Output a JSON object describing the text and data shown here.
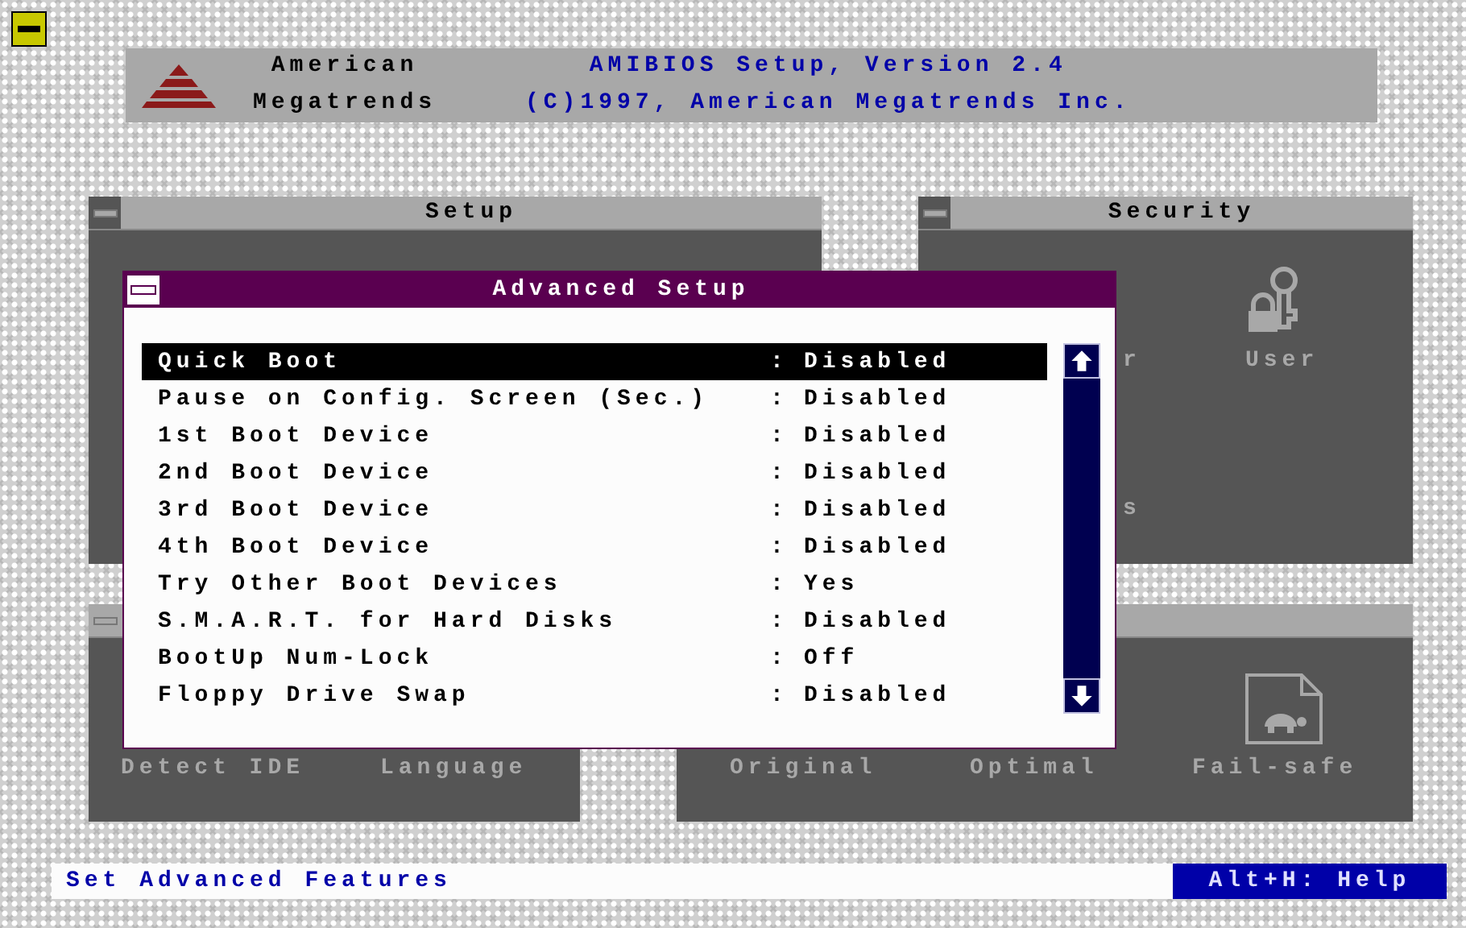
{
  "header": {
    "company": [
      "American",
      "Megatrends"
    ],
    "title": "AMIBIOS Setup, Version 2.4",
    "copyright": "(C)1997, American Megatrends Inc."
  },
  "windows": [
    {
      "kind": "setup",
      "title": "Setup"
    },
    {
      "kind": "security",
      "title": "Security",
      "items": [
        {
          "label": "r"
        },
        {
          "label": "User"
        },
        {
          "label": "s"
        }
      ]
    },
    {
      "kind": "utility",
      "items": [
        {
          "label": "Detect IDE"
        },
        {
          "label": "Language"
        }
      ]
    },
    {
      "kind": "default",
      "items": [
        {
          "label": "Original"
        },
        {
          "label": "Optimal"
        },
        {
          "label": "Fail-safe"
        }
      ]
    }
  ],
  "dialog": {
    "title": "Advanced Setup",
    "rows": [
      {
        "label": "Quick Boot",
        "separator": ":",
        "value": "Disabled",
        "selected": true
      },
      {
        "label": "Pause on Config. Screen (Sec.)",
        "separator": ":",
        "value": "Disabled",
        "selected": false
      },
      {
        "label": "1st Boot Device",
        "separator": ":",
        "value": "Disabled",
        "selected": false
      },
      {
        "label": "2nd Boot Device",
        "separator": ":",
        "value": "Disabled",
        "selected": false
      },
      {
        "label": "3rd Boot Device",
        "separator": ":",
        "value": "Disabled",
        "selected": false
      },
      {
        "label": "4th Boot Device",
        "separator": ":",
        "value": "Disabled",
        "selected": false
      },
      {
        "label": "Try Other Boot Devices",
        "separator": ":",
        "value": "Yes",
        "selected": false
      },
      {
        "label": "S.M.A.R.T. for Hard Disks",
        "separator": ":",
        "value": "Disabled",
        "selected": false
      },
      {
        "label": "BootUp Num-Lock",
        "separator": ":",
        "value": "Off",
        "selected": false
      },
      {
        "label": "Floppy Drive Swap",
        "separator": ":",
        "value": "Disabled",
        "selected": false
      }
    ]
  },
  "status_bar": {
    "message": "Set Advanced Features",
    "help": "Alt+H: Help"
  }
}
